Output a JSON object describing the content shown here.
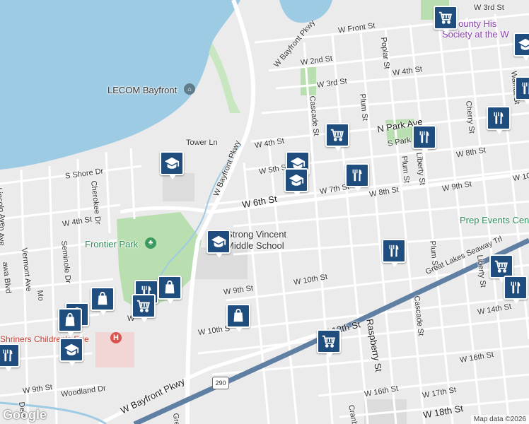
{
  "map": {
    "attribution": "Map data ©2026",
    "logo": "Google",
    "route_shield": "290"
  },
  "pois": {
    "lecom": "LECOM Bayfront",
    "frontier_park": "Frontier Park",
    "school": "Strong Vincent Middle School",
    "school_line1": "Strong Vincent",
    "school_line2": "Middle School",
    "prep_events": "Prep Events Cen",
    "historical_line1": "ie County His",
    "historical_line2": "Society at the W",
    "shriners": "Shriners Children's Erie"
  },
  "streets": {
    "w_bayfront_pkwy_top": "W Bayfront Pkwy",
    "w_front_st": "W Front St",
    "w_3rd_st_top": "W 3rd St",
    "w_2nd_st": "W 2nd St",
    "w_3rd_st": "W 3rd St",
    "w_4th_st_east": "W 4th St",
    "poplar_st_top": "Poplar St",
    "cascade_st": "Cascade St",
    "plum_st": "Plum St",
    "n_park_ave": "N Park Ave",
    "s_park": "S Park",
    "cherry_st": "Cherry St",
    "walnut_st": "Walnut St",
    "w_4th_st": "W 4th St",
    "w_5th_st": "W 5th St",
    "tower_ln": "Tower Ln",
    "w_bayfront_pkwy_diag": "W Bayfront Pkwy",
    "w_6th_st": "W 6th St",
    "w_7th_st": "W 7th St",
    "w_8th_st": "W 8th St",
    "w_8th_st_east": "W 8th St",
    "w_9th_st_east": "W 9th St",
    "plum_st_mid": "Plum St",
    "liberty_st": "Liberty St",
    "w_10th": "W 10",
    "s_shore_dr": "S Shore Dr",
    "cherokee_dr": "Cherokee Dr",
    "lincoln_ave": "Lincoln Ave",
    "w_4th_st_west": "W 4th St",
    "seminole_dr": "Seminole Dr",
    "vermont_ave": "Vermont Ave",
    "hiawa_blvd": "awa Blvd",
    "w_9th_st": "W 9th St",
    "w_10th_st_mid": "W 10th St",
    "w_10th_st": "W 10th S",
    "w_12th_st": "W 12th St",
    "raspberry_st": "Raspberry St",
    "cascade_st_south": "Cascade St",
    "plum_st_south": "Plum St",
    "liberty_st_south": "Liberty St",
    "w_14th_st": "W 14th St",
    "great_lakes_tr": "Great Lakes Seaway Trl",
    "w_16th_st": "W 16th St",
    "w_16th_st_east": "W 16th St",
    "w_17th_st": "W 17th St",
    "w_18th_st": "W 18th St",
    "w_9th_st_west": "W 9th St",
    "woodland_dr": "Woodland Dr",
    "w_bayfront_pkwy_bottom": "W Bayfront Pkwy",
    "cranberry": "Cranb",
    "gre": "Gre",
    "dela": "Dela",
    "mo": "Mo",
    "w_small": "W",
    "s0_ave": "0 Ave"
  },
  "marker_types": [
    "shopping-cart",
    "restaurant",
    "school",
    "shopping-bag"
  ]
}
